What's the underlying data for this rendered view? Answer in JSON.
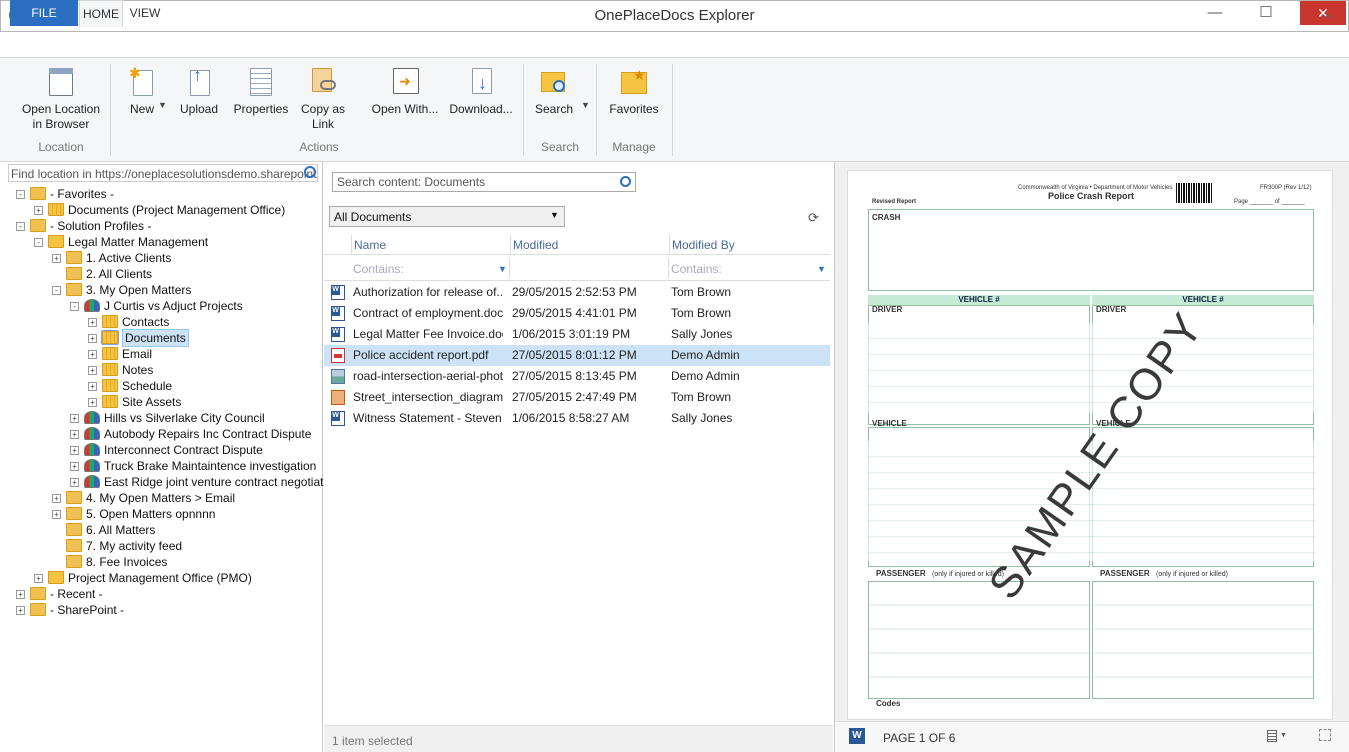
{
  "window": {
    "title": "OnePlaceDocs Explorer",
    "minimize": "—",
    "maximize": "☐",
    "close": "✕"
  },
  "ribbon": {
    "tabs": [
      {
        "label": "FILE"
      },
      {
        "label": "HOME"
      },
      {
        "label": "VIEW"
      }
    ],
    "buttons": {
      "open_location": "Open Location\nin Browser",
      "new": "New",
      "upload": "Upload",
      "properties": "Properties",
      "copy_link": "Copy as\nLink",
      "open_with": "Open  With...",
      "download": "Download...",
      "search": "Search",
      "favorites": "Favorites"
    },
    "groups": {
      "location": "Location",
      "actions": "Actions",
      "search": "Search",
      "manage": "Manage"
    }
  },
  "left": {
    "location_placeholder": "Find location in https://oneplacesolutionsdemo.sharepoint.cor",
    "tree": [
      {
        "label": "- Favorites -"
      },
      {
        "label": "Documents (Project Management Office)"
      },
      {
        "label": "- Solution Profiles -"
      },
      {
        "label": "Legal Matter Management"
      },
      {
        "label": "1. Active Clients"
      },
      {
        "label": "2. All Clients"
      },
      {
        "label": "3. My Open Matters"
      },
      {
        "label": "J Curtis vs Adjuct Projects"
      },
      {
        "label": "Contacts"
      },
      {
        "label": "Documents"
      },
      {
        "label": "Email"
      },
      {
        "label": "Notes"
      },
      {
        "label": "Schedule"
      },
      {
        "label": "Site Assets"
      },
      {
        "label": "Hills vs Silverlake City Council"
      },
      {
        "label": "Autobody Repairs Inc Contract Dispute"
      },
      {
        "label": "Interconnect Contract Dispute"
      },
      {
        "label": "Truck Brake Maintaintence investigation"
      },
      {
        "label": "East Ridge joint venture contract negotiation"
      },
      {
        "label": "4. My Open Matters > Email"
      },
      {
        "label": "5. Open Matters opnnnn"
      },
      {
        "label": "6. All Matters"
      },
      {
        "label": "7. My activity feed"
      },
      {
        "label": "8. Fee Invoices"
      },
      {
        "label": "Project Management Office (PMO)"
      },
      {
        "label": "- Recent -"
      },
      {
        "label": "- SharePoint -"
      }
    ]
  },
  "middle": {
    "search_placeholder": "Search content: Documents",
    "view": "All Documents",
    "columns": {
      "name": "Name",
      "modified": "Modified",
      "modified_by": "Modified By"
    },
    "filter_placeholder": "Contains:",
    "rows": [
      {
        "name": "Authorization for release of...",
        "modified": "29/05/2015 2:52:53 PM",
        "by": "Tom Brown",
        "type": "word"
      },
      {
        "name": "Contract of employment.docx",
        "modified": "29/05/2015 4:41:01 PM",
        "by": "Tom Brown",
        "type": "word"
      },
      {
        "name": "Legal Matter Fee Invoice.docx",
        "modified": "1/06/2015 3:01:19 PM",
        "by": "Sally Jones",
        "type": "word"
      },
      {
        "name": "Police accident report.pdf",
        "modified": "27/05/2015 8:01:12 PM",
        "by": "Demo Admin",
        "type": "pdf"
      },
      {
        "name": "road-intersection-aerial-phot...",
        "modified": "27/05/2015 8:13:45 PM",
        "by": "Demo Admin",
        "type": "image"
      },
      {
        "name": "Street_intersection_diagramp...",
        "modified": "27/05/2015 2:47:49 PM",
        "by": "Tom Brown",
        "type": "ppt"
      },
      {
        "name": "Witness Statement - Steven P...",
        "modified": "1/06/2015 8:58:27 AM",
        "by": "Sally Jones",
        "type": "word"
      }
    ],
    "status": "1 item selected"
  },
  "preview": {
    "page_label": "PAGE 1 OF 6",
    "doc": {
      "header1": "Commonwealth of Virginia • Department of Motor Vehicles",
      "header2": "Police Crash Report",
      "form_no": "FR300P (Rev 1/12)",
      "revised": "Revised Report",
      "page": "Page _______ of _______",
      "crash": "CRASH",
      "vehicle": "VEHICLE #",
      "driver": "DRIVER",
      "vehicle_sec": "VEHICLE",
      "passenger": "PASSENGER",
      "passenger_note": "(only if injured or killed)",
      "codes": "Codes",
      "watermark": "SAMPLE COPY"
    }
  }
}
